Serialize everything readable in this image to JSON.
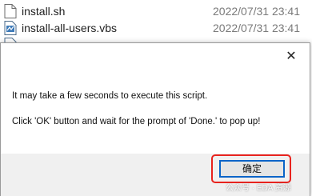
{
  "files": [
    {
      "name": "install.sh",
      "date": "2022/07/31 23:41",
      "icon": "document-icon"
    },
    {
      "name": "install-all-users.vbs",
      "date": "2022/07/31 23:41",
      "icon": "vbs-script-icon"
    },
    {
      "name": "",
      "date": "",
      "icon": "vbs-script-icon"
    }
  ],
  "dialog": {
    "close_glyph": "✕",
    "message_line1": "It may take a few seconds to execute this script.",
    "message_line2": "Click 'OK' button and wait for the prompt of 'Done.' to pop up!",
    "ok_label": "确定"
  },
  "watermark": "公众号 · EDA 资源",
  "colors": {
    "highlight": "#e8231e",
    "button_focus_border": "#0a64c8",
    "footer_bg": "#f0f0f0"
  }
}
